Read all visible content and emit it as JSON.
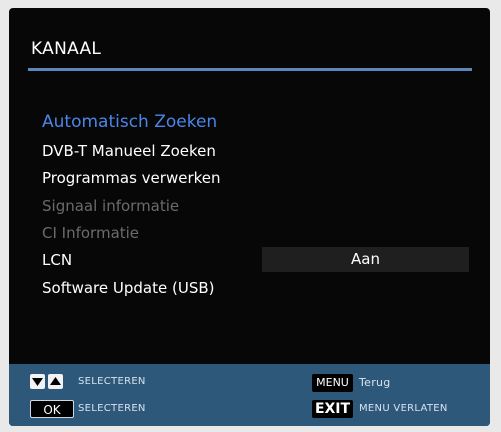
{
  "header": {
    "title": "KANAAL"
  },
  "menu": {
    "items": [
      {
        "label": "Automatisch Zoeken"
      },
      {
        "label": "DVB-T Manueel Zoeken"
      },
      {
        "label": "Programmas verwerken"
      },
      {
        "label": "Signaal informatie"
      },
      {
        "label": "CI Informatie"
      },
      {
        "label": "LCN",
        "value": "Aan"
      },
      {
        "label": "Software Update (USB)"
      }
    ]
  },
  "footer": {
    "nav_hint": "SELECTEREN",
    "ok_key": "OK",
    "ok_hint": "SELECTEREN",
    "menu_key": "MENU",
    "menu_hint": "Terug",
    "exit_key": "EXIT",
    "exit_hint": "MENU VERLATEN"
  },
  "colors": {
    "selected": "#4a86e8",
    "disabled": "#6b6b6b",
    "footer_bg": "#2e587a",
    "accent_rule": "#5d87b6"
  }
}
